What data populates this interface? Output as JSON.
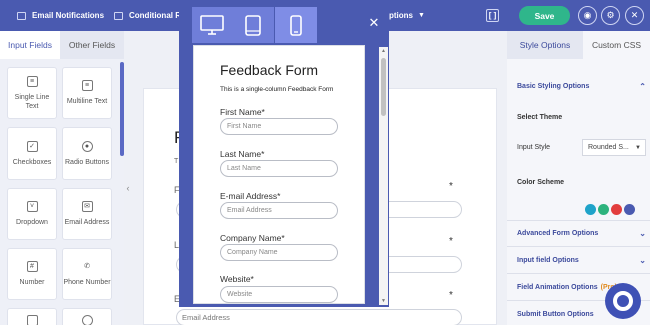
{
  "topbar": {
    "tab1": "Email Notifications",
    "tab2": "Conditional R",
    "tab3": "ptions",
    "bracket": "[ ]",
    "save": "Save"
  },
  "left": {
    "tabs": [
      "Input Fields",
      "Other Fields"
    ],
    "fields": [
      "Single Line Text",
      "Multiline Text",
      "Checkboxes",
      "Radio Buttons",
      "Dropdown",
      "Email Address",
      "Number",
      "Phone Number"
    ]
  },
  "background_form": {
    "letters": [
      "F",
      "T",
      "F",
      "L",
      "E"
    ],
    "email_placeholder": "Email Address"
  },
  "right": {
    "tabs": [
      "Style Options",
      "Custom CSS"
    ],
    "basic": "Basic Styling Options",
    "select_theme": "Select Theme",
    "input_style_label": "Input Style",
    "input_style_value": "Rounded S...",
    "color_scheme": "Color Scheme",
    "swatch_colors": [
      "#1fa3c9",
      "#2db37d",
      "#e23d3d",
      "#4a5ab0"
    ],
    "advanced": "Advanced Form Options",
    "input_field": "Input field Options",
    "animation": "Field Animation Options",
    "animation_badge": "(Pro)",
    "submit": "Submit Button Options"
  },
  "preview": {
    "title": "Feedback Form",
    "subtitle": "This is a single-column Feedback Form",
    "fields": [
      {
        "label": "First Name*",
        "placeholder": "First Name"
      },
      {
        "label": "Last Name*",
        "placeholder": "Last Name"
      },
      {
        "label": "E-mail Address*",
        "placeholder": "Email Address"
      },
      {
        "label": "Company Name*",
        "placeholder": "Company Name"
      },
      {
        "label": "Website*",
        "placeholder": "Website"
      }
    ]
  },
  "colors": {
    "primary": "#4a5ab0",
    "save": "#2fb68b",
    "active_device": "#6f7ed9"
  }
}
